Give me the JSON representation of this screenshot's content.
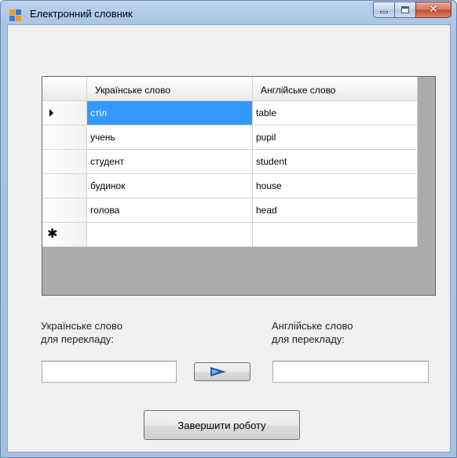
{
  "window": {
    "title": "Електронний словник",
    "colors": {
      "icon_orange": "#f39a2b",
      "icon_blue": "#3b78d8",
      "selection": "#3399ff"
    }
  },
  "grid": {
    "columns": [
      "Українське слово",
      "Англійське слово"
    ],
    "rows": [
      {
        "ukr": "стіл",
        "eng": "table"
      },
      {
        "ukr": "учень",
        "eng": "pupil"
      },
      {
        "ukr": "студент",
        "eng": "student"
      },
      {
        "ukr": "будинок",
        "eng": "house"
      },
      {
        "ukr": "голова",
        "eng": "head"
      }
    ],
    "current_row_marker": "current-row-arrow-icon",
    "new_row_marker": "new-row-asterisk-icon"
  },
  "form": {
    "ukr_label_line1": "Українське слово",
    "ukr_label_line2": "для перекладу:",
    "eng_label_line1": "Англійське слово",
    "eng_label_line2": "для перекладу:",
    "ukr_input_value": "",
    "eng_input_value": "",
    "translate_button_icon": "arrow-right-icon",
    "exit_button_label": "Завершити роботу"
  }
}
